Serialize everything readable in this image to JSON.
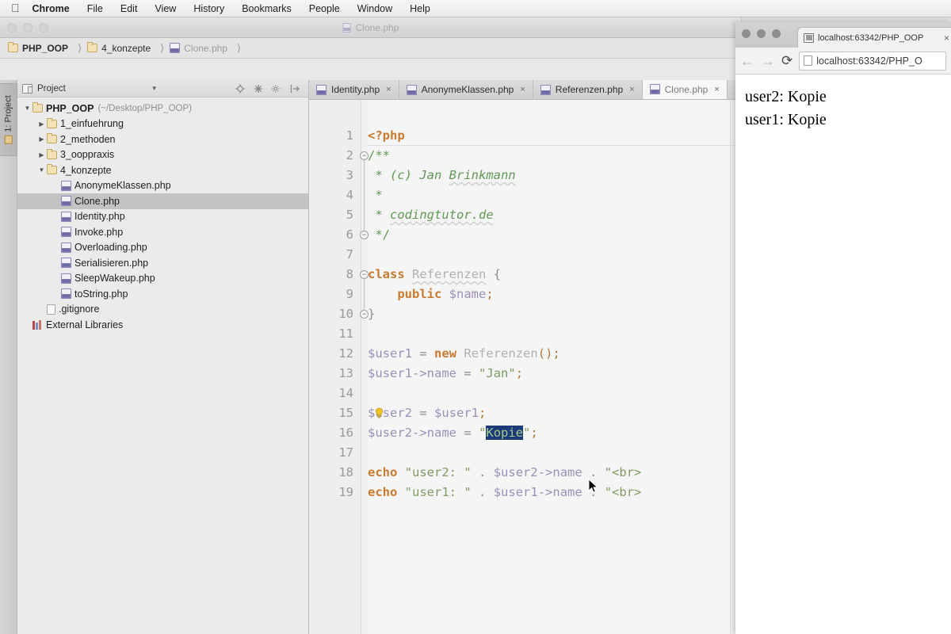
{
  "macbar": {
    "apple_icon": "apple-logo",
    "items": [
      {
        "label": "Chrome",
        "bold": true
      },
      {
        "label": "File",
        "bold": false
      },
      {
        "label": "Edit",
        "bold": false
      },
      {
        "label": "View",
        "bold": false
      },
      {
        "label": "History",
        "bold": false
      },
      {
        "label": "Bookmarks",
        "bold": false
      },
      {
        "label": "People",
        "bold": false
      },
      {
        "label": "Window",
        "bold": false
      },
      {
        "label": "Help",
        "bold": false
      }
    ]
  },
  "ide": {
    "window_title": "Clone.php",
    "breadcrumb": [
      {
        "label": "PHP_OOP",
        "icon": "folder-icon",
        "style": "strong"
      },
      {
        "label": "4_konzepte",
        "icon": "folder-icon",
        "style": "normal"
      },
      {
        "label": "Clone.php",
        "icon": "php-file-icon",
        "style": "muted"
      }
    ],
    "tool_window_tab": "1: Project",
    "project_panel": {
      "title": "Project",
      "toolbar_icons": [
        "locate-target-icon",
        "collapse-all-icon",
        "settings-gear-icon",
        "hide-panel-icon"
      ],
      "tree": [
        {
          "label": "PHP_OOP",
          "sub": "(~/Desktop/PHP_OOP)",
          "depth": 0,
          "arrow": "down",
          "icon": "folder-icon",
          "bold": true,
          "selected": false
        },
        {
          "label": "1_einfuehrung",
          "sub": "",
          "depth": 1,
          "arrow": "right",
          "icon": "folder-icon",
          "bold": false,
          "selected": false
        },
        {
          "label": "2_methoden",
          "sub": "",
          "depth": 1,
          "arrow": "right",
          "icon": "folder-icon",
          "bold": false,
          "selected": false
        },
        {
          "label": "3_ooppraxis",
          "sub": "",
          "depth": 1,
          "arrow": "right",
          "icon": "folder-icon",
          "bold": false,
          "selected": false
        },
        {
          "label": "4_konzepte",
          "sub": "",
          "depth": 1,
          "arrow": "down",
          "icon": "folder-icon",
          "bold": false,
          "selected": false
        },
        {
          "label": "AnonymeKlassen.php",
          "sub": "",
          "depth": 2,
          "arrow": "none",
          "icon": "php-file-icon",
          "bold": false,
          "selected": false
        },
        {
          "label": "Clone.php",
          "sub": "",
          "depth": 2,
          "arrow": "none",
          "icon": "php-file-icon",
          "bold": false,
          "selected": true
        },
        {
          "label": "Identity.php",
          "sub": "",
          "depth": 2,
          "arrow": "none",
          "icon": "php-file-icon",
          "bold": false,
          "selected": false
        },
        {
          "label": "Invoke.php",
          "sub": "",
          "depth": 2,
          "arrow": "none",
          "icon": "php-file-icon",
          "bold": false,
          "selected": false
        },
        {
          "label": "Overloading.php",
          "sub": "",
          "depth": 2,
          "arrow": "none",
          "icon": "php-file-icon",
          "bold": false,
          "selected": false
        },
        {
          "label": "Serialisieren.php",
          "sub": "",
          "depth": 2,
          "arrow": "none",
          "icon": "php-file-icon",
          "bold": false,
          "selected": false
        },
        {
          "label": "SleepWakeup.php",
          "sub": "",
          "depth": 2,
          "arrow": "none",
          "icon": "php-file-icon",
          "bold": false,
          "selected": false
        },
        {
          "label": "toString.php",
          "sub": "",
          "depth": 2,
          "arrow": "none",
          "icon": "php-file-icon",
          "bold": false,
          "selected": false
        },
        {
          "label": ".gitignore",
          "sub": "",
          "depth": 1,
          "arrow": "none",
          "icon": "plain-file-icon",
          "bold": false,
          "selected": false
        },
        {
          "label": "External Libraries",
          "sub": "",
          "depth": 0,
          "arrow": "none",
          "icon": "library-icon",
          "bold": false,
          "selected": false
        }
      ]
    },
    "editor_tabs": [
      {
        "label": "Identity.php",
        "active": false
      },
      {
        "label": "AnonymeKlassen.php",
        "active": false
      },
      {
        "label": "Referenzen.php",
        "active": false
      },
      {
        "label": "Clone.php",
        "active": true
      }
    ],
    "code": {
      "line_numbers": [
        "1",
        "2",
        "3",
        "4",
        "5",
        "6",
        "7",
        "8",
        "9",
        "10",
        "11",
        "12",
        "13",
        "14",
        "15",
        "16",
        "17",
        "18",
        "19"
      ],
      "lines": [
        "<?php",
        "/**",
        " * (c) Jan Brinkmann",
        " *",
        " * codingtutor.de",
        " */",
        "",
        "class Referenzen {",
        "    public $name;",
        "}",
        "",
        "$user1 = new Referenzen();",
        "$user1->name = \"Jan\";",
        "",
        "$user2 = $user1;",
        "$user2->name = \"Kopie\";",
        "",
        "echo \"user2: \" . $user2->name . \"<br>",
        "echo \"user1: \" . $user1->name . \"<br>"
      ],
      "selected_text": "Kopie",
      "selection_line": 16
    }
  },
  "chrome": {
    "tab_title": "localhost:63342/PHP_OOP",
    "url": "localhost:63342/PHP_O",
    "nav_back": "←",
    "nav_forward": "→",
    "reload": "⟳",
    "page_output": [
      "user2: Kopie",
      "user1: Kopie"
    ]
  },
  "colors": {
    "keyword": "#c87a2f",
    "comment": "#629755",
    "string": "#7f9b63",
    "variable": "#9b8fb8",
    "selection": "#1b3a78",
    "selected_row": "#c3c3c3"
  }
}
